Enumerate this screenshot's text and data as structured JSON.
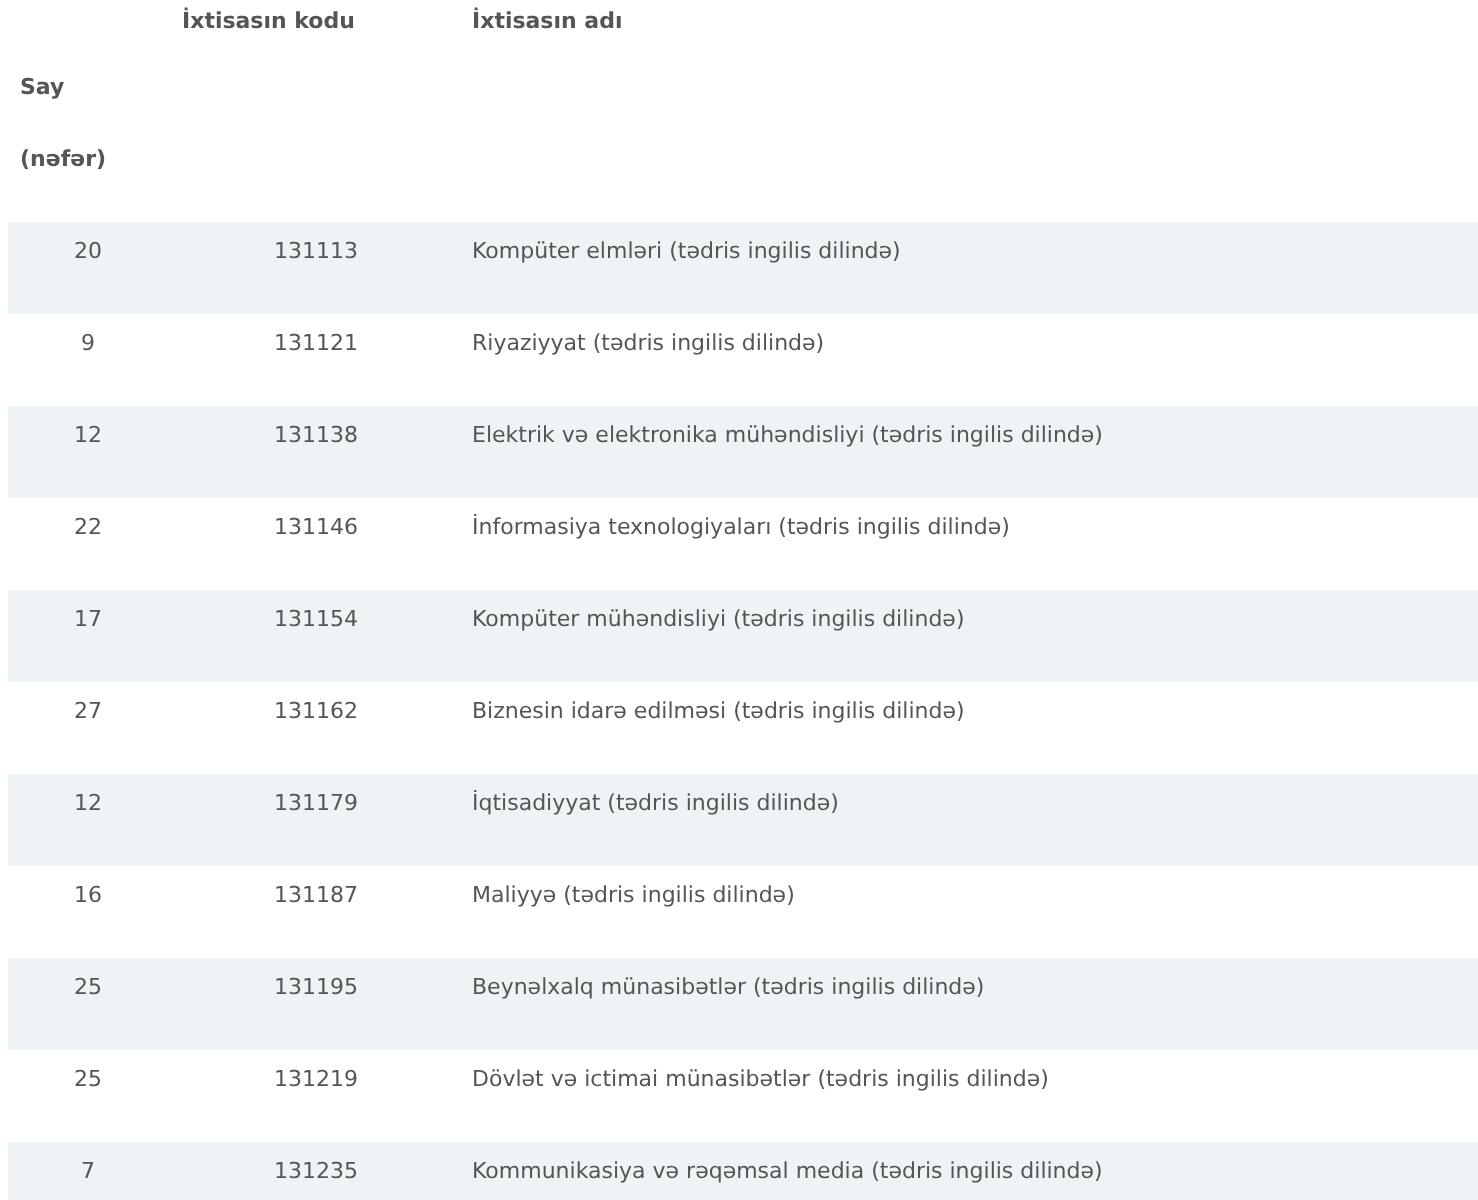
{
  "table": {
    "columns": [
      {
        "lines": [
          "Say",
          "(nəfər)"
        ]
      },
      {
        "lines": [
          "İxtisasın kodu"
        ]
      },
      {
        "lines": [
          "İxtisasın adı"
        ]
      }
    ],
    "rows": [
      {
        "count": "20",
        "code": "131113",
        "name": "Kompüter elmləri (tədris ingilis dilində)"
      },
      {
        "count": "9",
        "code": "131121",
        "name": "Riyaziyyat (tədris ingilis dilində)"
      },
      {
        "count": "12",
        "code": "131138",
        "name": "Elektrik və elektronika mühəndisliyi (tədris ingilis dilində)"
      },
      {
        "count": "22",
        "code": "131146",
        "name": "İnformasiya texnologiyaları (tədris ingilis dilində)"
      },
      {
        "count": "17",
        "code": "131154",
        "name": "Kompüter mühəndisliyi (tədris ingilis dilində)"
      },
      {
        "count": "27",
        "code": "131162",
        "name": "Biznesin idarə edilməsi (tədris ingilis dilində)"
      },
      {
        "count": "12",
        "code": "131179",
        "name": "İqtisadiyyat (tədris ingilis dilində)"
      },
      {
        "count": "16",
        "code": "131187",
        "name": "Maliyyə (tədris ingilis dilində)"
      },
      {
        "count": "25",
        "code": "131195",
        "name": "Beynəlxalq münasibətlər (tədris ingilis dilində)"
      },
      {
        "count": "25",
        "code": "131219",
        "name": "Dövlət və ictimai münasibətlər (tədris ingilis dilində)"
      },
      {
        "count": "7",
        "code": "131235",
        "name": "Kommunikasiya və rəqəmsal media (tədris ingilis dilində)"
      }
    ]
  }
}
